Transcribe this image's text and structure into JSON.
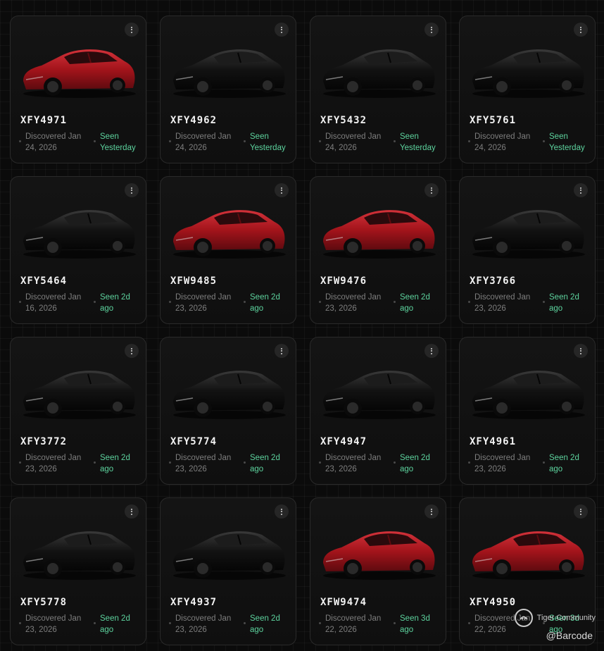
{
  "colors": {
    "background": "#0b0b0b",
    "card": "#141414",
    "text_primary": "#f2f2f2",
    "text_muted": "#7e7e7e",
    "seen_green": "#5dd39e",
    "car_red": "#a3141b",
    "car_black": "#121212"
  },
  "cars": [
    {
      "plate": "XFY4971",
      "discovered": "Discovered Jan 24, 2026",
      "seen": "Seen Yesterday",
      "color": "red"
    },
    {
      "plate": "XFY4962",
      "discovered": "Discovered Jan 24, 2026",
      "seen": "Seen Yesterday",
      "color": "black"
    },
    {
      "plate": "XFY5432",
      "discovered": "Discovered Jan 24, 2026",
      "seen": "Seen Yesterday",
      "color": "black"
    },
    {
      "plate": "XFY5761",
      "discovered": "Discovered Jan 24, 2026",
      "seen": "Seen Yesterday",
      "color": "black"
    },
    {
      "plate": "XFY5464",
      "discovered": "Discovered Jan 16, 2026",
      "seen": "Seen 2d ago",
      "color": "black"
    },
    {
      "plate": "XFW9485",
      "discovered": "Discovered Jan 23, 2026",
      "seen": "Seen 2d ago",
      "color": "red"
    },
    {
      "plate": "XFW9476",
      "discovered": "Discovered Jan 23, 2026",
      "seen": "Seen 2d ago",
      "color": "red"
    },
    {
      "plate": "XFY3766",
      "discovered": "Discovered Jan 23, 2026",
      "seen": "Seen 2d ago",
      "color": "black"
    },
    {
      "plate": "XFY3772",
      "discovered": "Discovered Jan 23, 2026",
      "seen": "Seen 2d ago",
      "color": "black"
    },
    {
      "plate": "XFY5774",
      "discovered": "Discovered Jan 23, 2026",
      "seen": "Seen 2d ago",
      "color": "black"
    },
    {
      "plate": "XFY4947",
      "discovered": "Discovered Jan 23, 2026",
      "seen": "Seen 2d ago",
      "color": "black"
    },
    {
      "plate": "XFY4961",
      "discovered": "Discovered Jan 23, 2026",
      "seen": "Seen 2d ago",
      "color": "black"
    },
    {
      "plate": "XFY5778",
      "discovered": "Discovered Jan 23, 2026",
      "seen": "Seen 2d ago",
      "color": "black"
    },
    {
      "plate": "XFY4937",
      "discovered": "Discovered Jan 23, 2026",
      "seen": "Seen 2d ago",
      "color": "black"
    },
    {
      "plate": "XFW9474",
      "discovered": "Discovered Jan 22, 2026",
      "seen": "Seen 3d ago",
      "color": "red"
    },
    {
      "plate": "XFY4950",
      "discovered": "Discovered Jan 22, 2026",
      "seen": "Seen 3d ago",
      "color": "red"
    }
  ],
  "menu_icon": "more-vertical-icon",
  "watermark": {
    "text": "Tiger Community",
    "handle": "@Barcode",
    "icon": "tiger-logo-icon"
  }
}
